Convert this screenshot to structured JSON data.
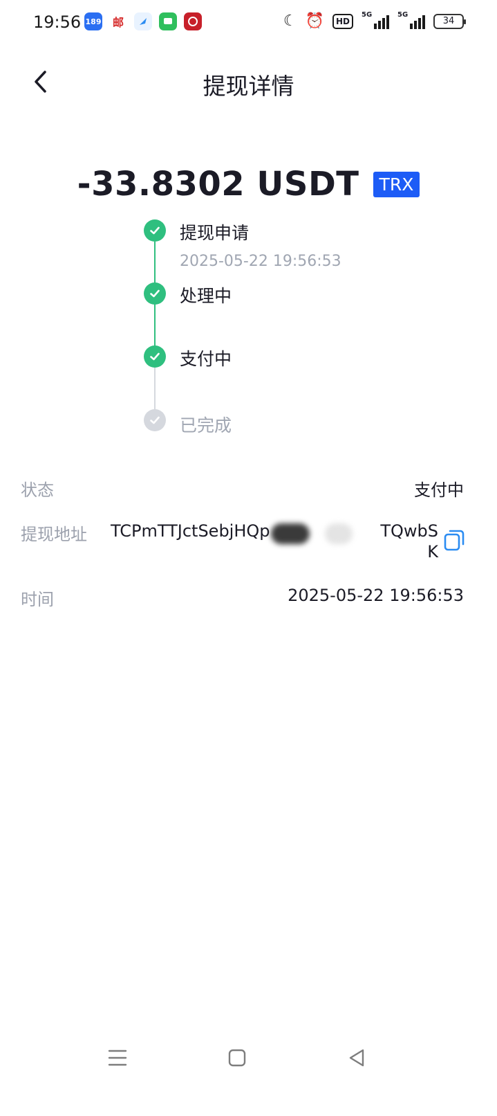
{
  "status_bar": {
    "time": "19:56",
    "apps": [
      "189",
      "邮",
      "browser",
      "messages",
      "bank"
    ],
    "hd": "HD",
    "signal_label": "5G",
    "battery": "34"
  },
  "header": {
    "back_icon": "chevron-left-icon",
    "title": "提现详情"
  },
  "amount": {
    "value": "-33.8302 USDT",
    "chain": "TRX"
  },
  "timeline": [
    {
      "label": "提现申请",
      "time": "2025-05-22 19:56:53",
      "done": true
    },
    {
      "label": "处理中",
      "time": "",
      "done": true
    },
    {
      "label": "支付中",
      "time": "",
      "done": true
    },
    {
      "label": "已完成",
      "time": "",
      "done": false
    }
  ],
  "details": {
    "status_label": "状态",
    "status_value": "支付中",
    "address_label": "提现地址",
    "address_value": "TCPmTTJctSebjHQp                    TQwbSK",
    "address_prefix": "TCPmTTJctSebjHQp",
    "address_suffix": "TQwbS",
    "address_suffix_wrap": "K",
    "time_label": "时间",
    "time_value": "2025-05-22 19:56:53"
  },
  "colors": {
    "accent": "#1d5cf6",
    "success": "#2fbf7f",
    "pending": "#d5d8de",
    "muted_text": "#9ca1ad"
  }
}
